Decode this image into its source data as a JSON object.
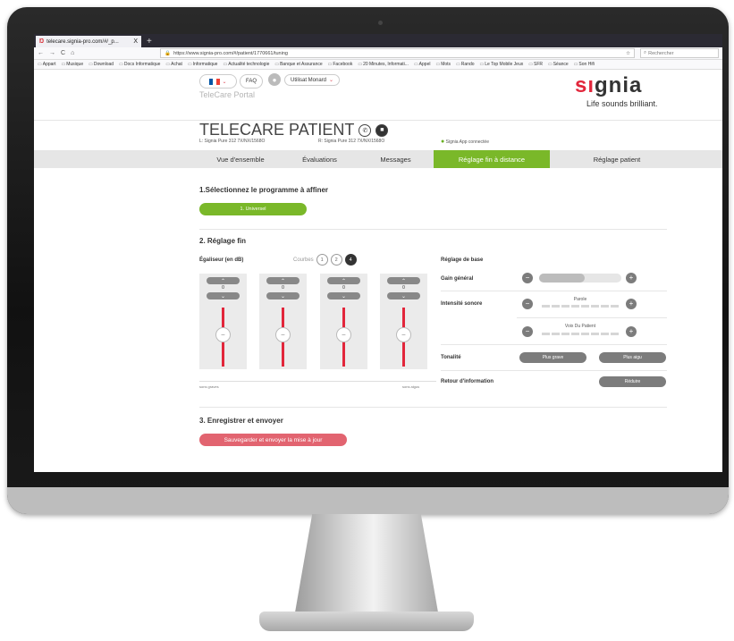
{
  "browser": {
    "tab_title": "telecare.signia-pro.com/#/_p...",
    "tab_close": "X",
    "new_tab": "+",
    "url": "https://www.signia-pro.com/#/patient/1770661/tuning",
    "search_placeholder": "Rechercher",
    "nav_back": "←",
    "nav_forward": "→",
    "nav_reload": "C",
    "nav_home": "⌂",
    "bookmarks": [
      "Appart",
      "Musique",
      "Download",
      "Docs Informatique",
      "Achat",
      "Informatique",
      "Actualité technologie",
      "Banque et Assurance",
      "Facebook",
      "20 Minutes, Informati...",
      "Appel",
      "Mots",
      "Rando",
      "Le Top Mobile Jeux",
      "SFR",
      "Séance",
      "Son Hifi"
    ]
  },
  "header": {
    "lang_flag_colors": [
      "#0055a4",
      "#ffffff",
      "#ef4135"
    ],
    "lang_chevron": "⌄",
    "faq": "FAQ",
    "user_name": "Utilisat Monard",
    "user_chevron": "⌄",
    "portal_label": "TeleCare Portal",
    "logo_mark": "sı",
    "logo_text": "gnia",
    "tagline": "Life sounds brilliant."
  },
  "patient": {
    "title": "TELECARE PATIENT",
    "phone_icon": "✆",
    "video_icon": "■",
    "left_device": "L: Signia Pure 312 7X/NX/1568O",
    "right_device": "R: Signia Pure 312 7X/NX/1568O",
    "app_status": "Signia App connectée"
  },
  "tabs": [
    {
      "label": "Vue d'ensemble"
    },
    {
      "label": "Évaluations"
    },
    {
      "label": "Messages"
    },
    {
      "label": "Réglage fin à distance"
    },
    {
      "label": "Réglage patient"
    }
  ],
  "colors": {
    "accent_green": "#7ab829",
    "accent_red": "#e26470",
    "track_red": "#e2263b"
  },
  "program": {
    "title": "1.Sélectionnez le programme à affiner",
    "button": "1. Universel"
  },
  "fine_tuning": {
    "title": "2. Réglage fin",
    "eq_label": "Égaliseur (en dB)",
    "curves_label": "Courbes",
    "curves": [
      "1",
      "2",
      "4"
    ],
    "eq_values": [
      "0",
      "0",
      "0",
      "0"
    ],
    "up": "⌃",
    "down": "⌄",
    "knob": "–",
    "axis_left": "sons graves",
    "axis_right": "sons aigus",
    "base_title": "Réglage de base",
    "gain_label": "Gain général",
    "gain_level": 0.55,
    "intensity_label": "Intensité sonore",
    "parole_label": "Parole",
    "voice_label": "Voix Du Patient",
    "minus": "−",
    "plus": "+",
    "tonality_label": "Tonalité",
    "tone_grave": "Plus grave",
    "tone_aigu": "Plus aigu",
    "feedback_label": "Retour d'information",
    "feedback_button": "Réduire"
  },
  "save": {
    "title": "3. Enregistrer et envoyer",
    "button": "Sauvegarder et envoyer la mise à jour"
  }
}
